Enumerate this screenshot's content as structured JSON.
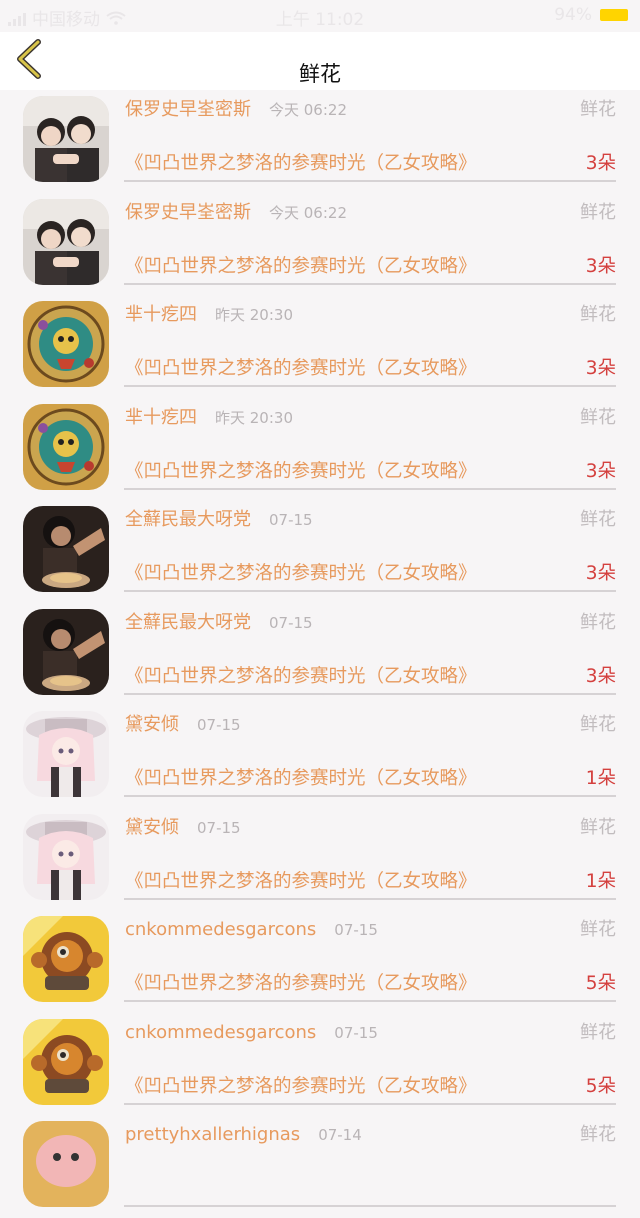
{
  "status_bar": {
    "carrier": "中国移动",
    "time": "上午 11:02",
    "battery_pct": "94%",
    "icons": [
      "signal-icon",
      "wifi-icon",
      "battery-icon"
    ]
  },
  "header": {
    "title": "鲜花",
    "back_icon": "chevron-left-icon",
    "accent_color": "#d8c44a"
  },
  "colors": {
    "name": "#e79a5e",
    "count": "#d4403e",
    "type": "#c1bcbe",
    "time": "#b9b4b6"
  },
  "items": [
    {
      "name": "保罗史早峑密斯",
      "time": "今天 06:22",
      "type": "鲜花",
      "game": "《凹凸世界之梦洛的参赛时光（乙女攻略》",
      "count": "3朵",
      "avatar": "photo-two-girls"
    },
    {
      "name": "保罗史早峑密斯",
      "time": "今天 06:22",
      "type": "鲜花",
      "game": "《凹凸世界之梦洛的参赛时光（乙女攻略》",
      "count": "3朵",
      "avatar": "photo-two-girls"
    },
    {
      "name": "芈十疙四",
      "time": "昨天 20:30",
      "type": "鲜花",
      "game": "《凹凸世界之梦洛的参赛时光（乙女攻略》",
      "count": "3朵",
      "avatar": "circular-emblem-art"
    },
    {
      "name": "芈十疙四",
      "time": "昨天 20:30",
      "type": "鲜花",
      "game": "《凹凸世界之梦洛的参赛时光（乙女攻略》",
      "count": "3朵",
      "avatar": "circular-emblem-art"
    },
    {
      "name": "全蘚民最大呀党",
      "time": "07-15",
      "type": "鲜花",
      "game": "《凹凸世界之梦洛的参赛时光（乙女攻略》",
      "count": "3朵",
      "avatar": "photo-woman-dining"
    },
    {
      "name": "全蘚民最大呀党",
      "time": "07-15",
      "type": "鲜花",
      "game": "《凹凸世界之梦洛的参赛时光（乙女攻略》",
      "count": "3朵",
      "avatar": "photo-woman-dining"
    },
    {
      "name": "黛安倾",
      "time": "07-15",
      "type": "鲜花",
      "game": "《凹凸世界之梦洛的参赛时光（乙女攻略》",
      "count": "1朵",
      "avatar": "anime-girl-hat"
    },
    {
      "name": "黛安倾",
      "time": "07-15",
      "type": "鲜花",
      "game": "《凹凸世界之梦洛的参赛时光（乙女攻略》",
      "count": "1朵",
      "avatar": "anime-girl-hat"
    },
    {
      "name": "cnkommedesgarcons",
      "time": "07-15",
      "type": "鲜花",
      "game": "《凹凸世界之梦洛的参赛时光（乙女攻略》",
      "count": "5朵",
      "avatar": "game-robot-character"
    },
    {
      "name": "cnkommedesgarcons",
      "time": "07-15",
      "type": "鲜花",
      "game": "《凹凸世界之梦洛的参赛时光（乙女攻略》",
      "count": "5朵",
      "avatar": "game-robot-character"
    },
    {
      "name": "prettyhxallerhignas",
      "time": "07-14",
      "type": "鲜花",
      "game": "",
      "count": "",
      "avatar": "cartoon-pink-character"
    }
  ]
}
